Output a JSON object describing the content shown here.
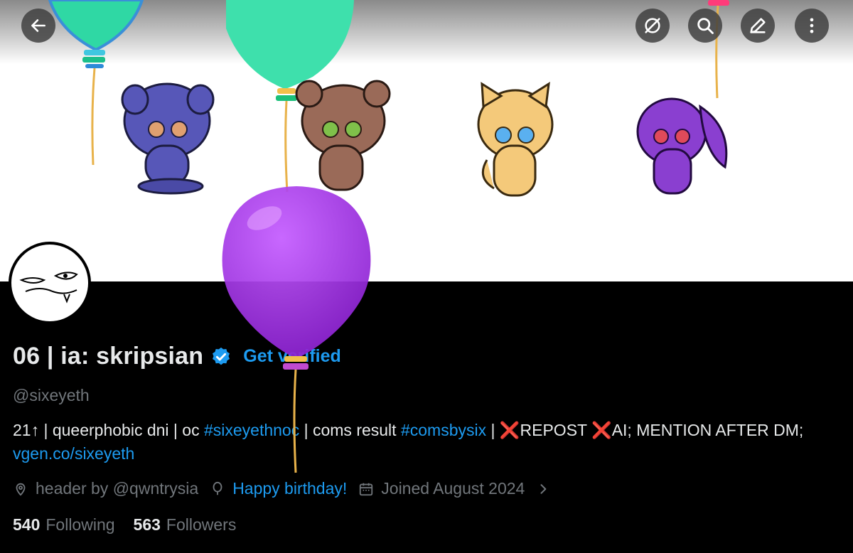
{
  "nav": {
    "back_icon": "arrow-left-icon",
    "hide_icon": "eye-slash-icon",
    "search_icon": "search-icon",
    "edit_icon": "pencil-icon",
    "more_icon": "more-vertical-icon"
  },
  "profile": {
    "display_name": "06 | ia: skripsian",
    "verify_cta": "Get verified",
    "handle": "@sixeyeth",
    "bio": {
      "part1": "21↑ | queerphobic dni | oc ",
      "tag1": "#sixeyethnoc",
      "part2": " | coms result ",
      "tag2": "#comsbysix",
      "part3": " | ",
      "cross1": "❌",
      "part4": "REPOST ",
      "cross2": "❌",
      "part5": "AI; MENTION AFTER DM; ",
      "link": "vgen.co/sixeyeth"
    },
    "location": "header by @qwntrysia",
    "birthday": "Happy birthday!",
    "joined": "Joined August 2024",
    "following_count": "540",
    "following_label": "Following",
    "followers_count": "563",
    "followers_label": "Followers"
  },
  "colors": {
    "accent": "#1d9bf0",
    "background": "#000000",
    "text": "#e7e9ea",
    "muted": "#71767b",
    "balloon_teal": "#2fd8a4",
    "balloon_purple": "#9b2fe0"
  }
}
